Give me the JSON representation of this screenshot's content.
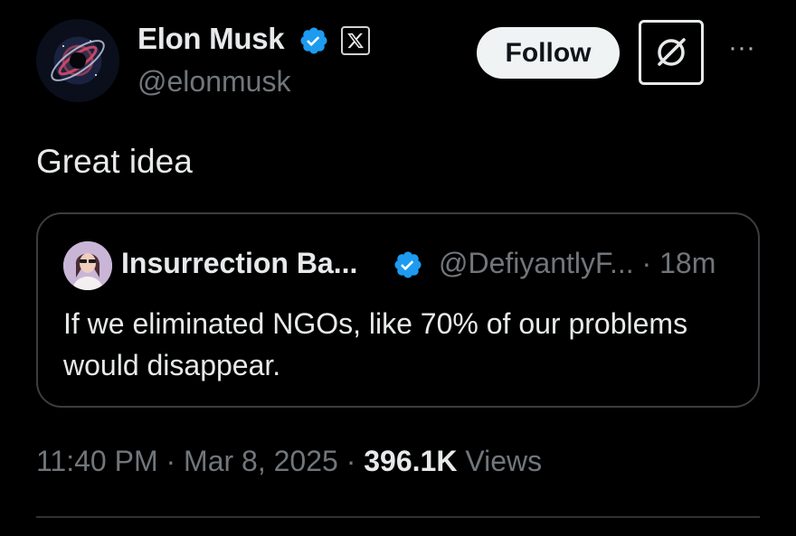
{
  "author": {
    "name": "Elon Musk",
    "handle": "@elonmusk",
    "avatar_icon": "galaxy-avatar",
    "verified_icon": "verified-badge-icon",
    "affiliation_icon": "x-logo-icon"
  },
  "actions": {
    "follow_label": "Follow",
    "grok_icon": "grok-icon",
    "more_icon": "more-options-icon",
    "more_label": "···"
  },
  "tweet": {
    "text": "Great idea"
  },
  "quote": {
    "name": "Insurrection Ba...",
    "handle": "@DefiyantlyF...",
    "separator": " · ",
    "time": "18m",
    "text": "If we eliminated NGOs, like 70% of our problems would disappear."
  },
  "meta": {
    "time": "11:40 PM",
    "sep1": " · ",
    "date": "Mar 8, 2025",
    "sep2": " · ",
    "views_count": "396.1K",
    "views_label": " Views"
  },
  "colors": {
    "background": "#000000",
    "text_primary": "#e7e9ea",
    "text_secondary": "#71767b",
    "verified_blue": "#1d9bf0",
    "border": "#3a3d41"
  }
}
